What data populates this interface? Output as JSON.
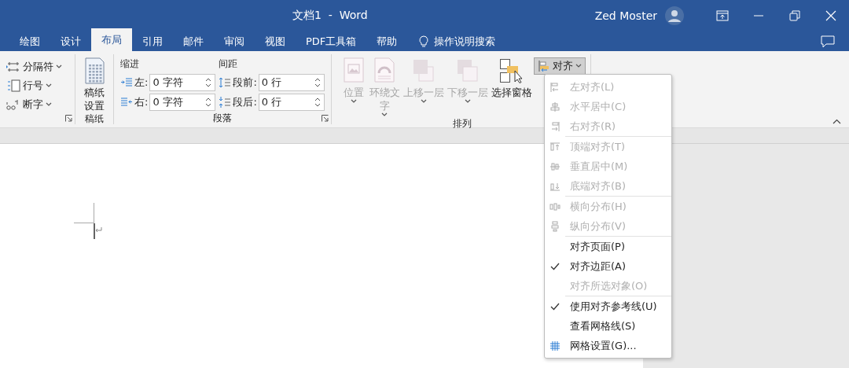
{
  "window": {
    "title": "文档1  -  Word",
    "user": "Zed Moster"
  },
  "tabs": [
    {
      "label": "绘图",
      "selected": false
    },
    {
      "label": "设计",
      "selected": false
    },
    {
      "label": "布局",
      "selected": true
    },
    {
      "label": "引用",
      "selected": false
    },
    {
      "label": "邮件",
      "selected": false
    },
    {
      "label": "审阅",
      "selected": false
    },
    {
      "label": "视图",
      "selected": false
    },
    {
      "label": "PDF工具箱",
      "selected": false
    },
    {
      "label": "帮助",
      "selected": false
    }
  ],
  "tell_me": {
    "label": "操作说明搜索"
  },
  "ribbon": {
    "groups": [
      {
        "kind": "page_setup",
        "launcher": true,
        "items": [
          {
            "label": "分隔符"
          },
          {
            "label": "行号"
          },
          {
            "label": "断字"
          }
        ]
      },
      {
        "kind": "manuscript",
        "label": "稿纸",
        "button": "稿纸设置"
      },
      {
        "kind": "paragraph",
        "label": "段落",
        "launcher": true,
        "indent": {
          "heading": "缩进",
          "fields": [
            {
              "label": "左:",
              "value": "0 字符"
            },
            {
              "label": "右:",
              "value": "0 字符"
            }
          ]
        },
        "spacing": {
          "heading": "间距",
          "fields": [
            {
              "label": "段前:",
              "value": "0 行"
            },
            {
              "label": "段后:",
              "value": "0 行"
            }
          ]
        }
      },
      {
        "kind": "arrange",
        "label": "排列",
        "buttons": [
          {
            "label": "位置",
            "disabled": true,
            "dropdown": true
          },
          {
            "label": "环绕文字",
            "disabled": true,
            "dropdown": true
          },
          {
            "label": "上移一层",
            "disabled": true,
            "dropdown": true
          },
          {
            "label": "下移一层",
            "disabled": true,
            "dropdown": true
          },
          {
            "label": "选择窗格",
            "disabled": false
          }
        ],
        "align": {
          "label": "对齐",
          "expanded": true
        }
      }
    ]
  },
  "menu": {
    "sections": [
      {
        "items": [
          {
            "label": "左对齐(L)",
            "disabled": true,
            "checked": false
          },
          {
            "label": "水平居中(C)",
            "disabled": true,
            "checked": false
          },
          {
            "label": "右对齐(R)",
            "disabled": true,
            "checked": false
          }
        ]
      },
      {
        "items": [
          {
            "label": "顶端对齐(T)",
            "disabled": true,
            "checked": false
          },
          {
            "label": "垂直居中(M)",
            "disabled": true,
            "checked": false
          },
          {
            "label": "底端对齐(B)",
            "disabled": true,
            "checked": false
          }
        ]
      },
      {
        "items": [
          {
            "label": "横向分布(H)",
            "disabled": true,
            "checked": false
          },
          {
            "label": "纵向分布(V)",
            "disabled": true,
            "checked": false
          }
        ]
      },
      {
        "items": [
          {
            "label": "对齐页面(P)",
            "disabled": false,
            "checked": false
          },
          {
            "label": "对齐边距(A)",
            "disabled": false,
            "checked": true
          },
          {
            "label": "对齐所选对象(O)",
            "disabled": true,
            "checked": false
          }
        ]
      },
      {
        "items": [
          {
            "label": "使用对齐参考线(U)",
            "disabled": false,
            "checked": true
          },
          {
            "label": "查看网格线(S)",
            "disabled": false,
            "checked": false
          },
          {
            "label": "网格设置(G)...",
            "disabled": false,
            "checked": false
          }
        ]
      }
    ]
  }
}
